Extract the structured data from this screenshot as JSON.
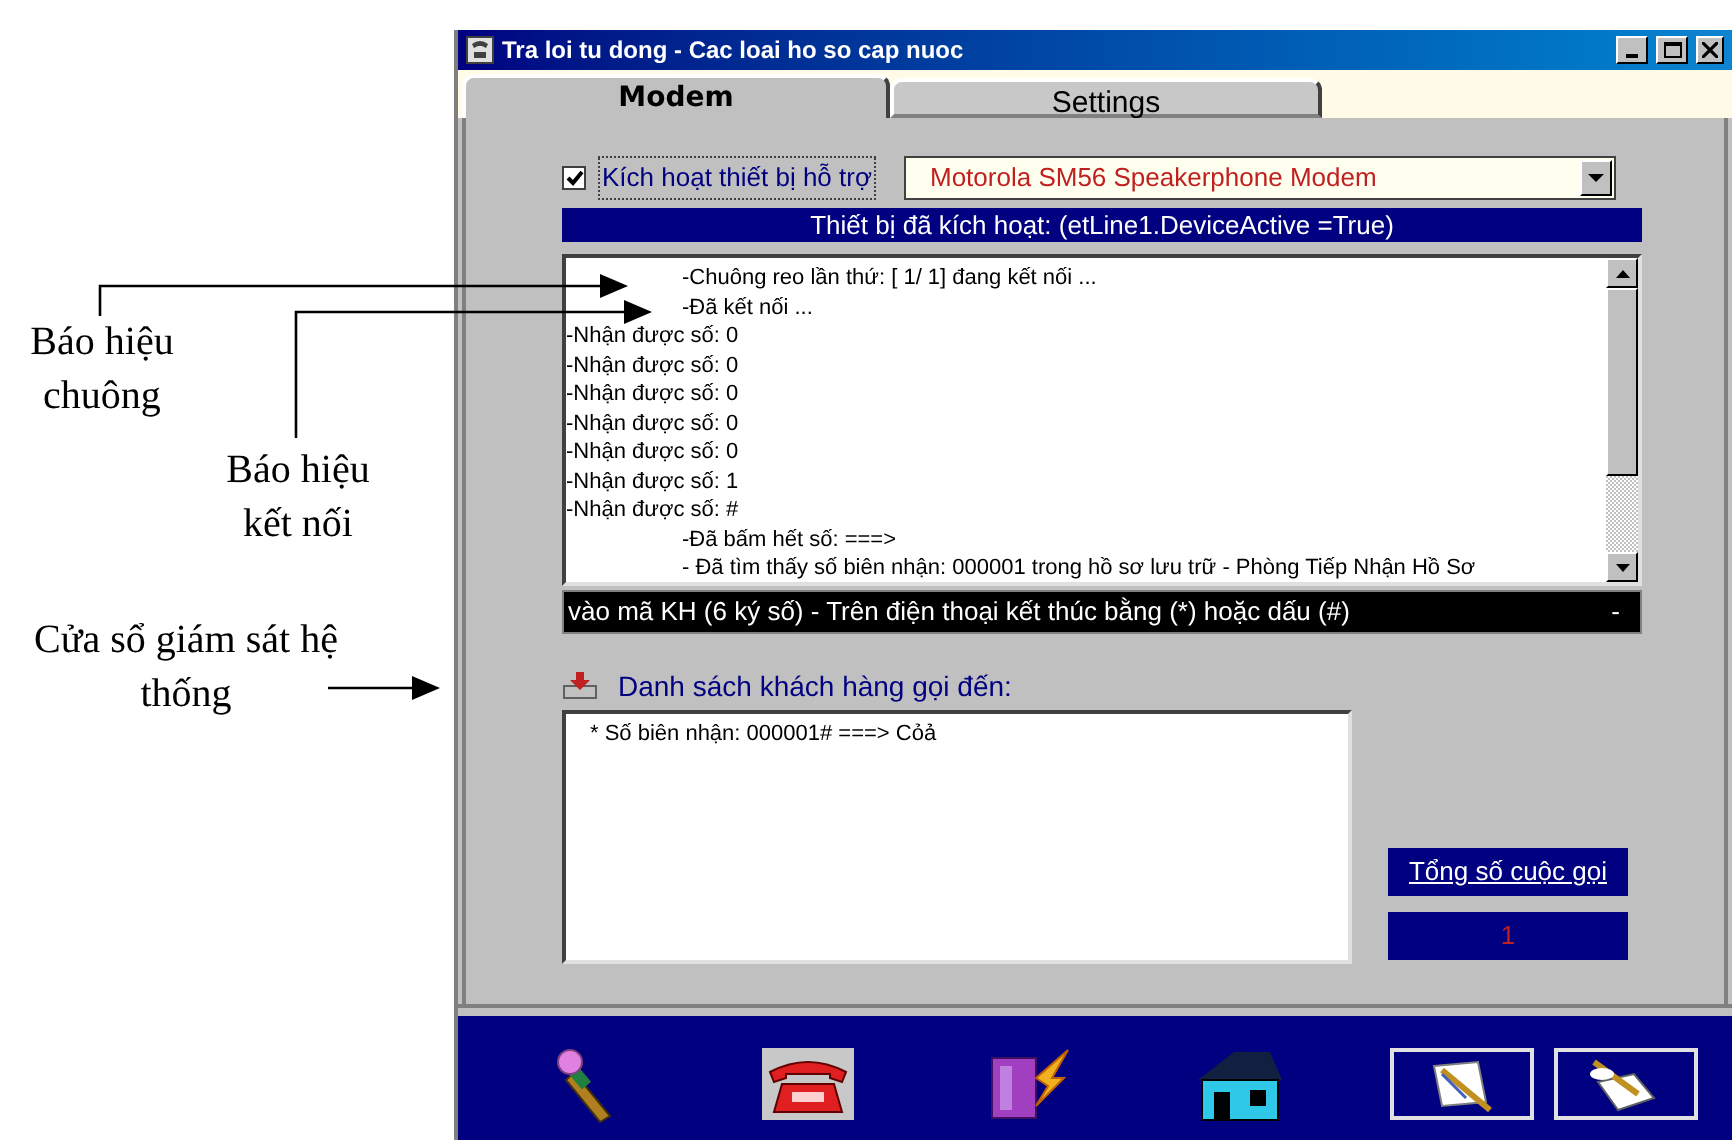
{
  "annotations": [
    {
      "text": "Báo hiệu chuông"
    },
    {
      "text": "Báo hiệu kết nối"
    },
    {
      "text": "Cửa sổ giám sát hệ thống"
    }
  ],
  "window": {
    "title": "Tra loi tu dong - Cac loai ho so cap nuoc"
  },
  "tabs": [
    {
      "label": "Modem",
      "selected": true
    },
    {
      "label": "Settings",
      "selected": false
    }
  ],
  "device": {
    "checkbox_label": "Kích hoạt thiết bị hỗ trợ",
    "checked": true,
    "modem": "Motorola SM56 Speakerphone Modem"
  },
  "status_banner": "Thiết bị đã kích hoạt: (etLine1.DeviceActive =True)",
  "log": [
    {
      "kind": "event",
      "text": "-Chuông reo lần thứ:  [ 1/ 1] đang kết nối ..."
    },
    {
      "kind": "event",
      "text": "-Đã kết nối ..."
    },
    {
      "kind": "digit",
      "text": "-Nhận được số: 0"
    },
    {
      "kind": "digit",
      "text": "-Nhận được số: 0"
    },
    {
      "kind": "digit",
      "text": "-Nhận được số: 0"
    },
    {
      "kind": "digit",
      "text": "-Nhận được số: 0"
    },
    {
      "kind": "digit",
      "text": "-Nhận được số: 0"
    },
    {
      "kind": "digit",
      "text": "-Nhận được số: 1"
    },
    {
      "kind": "digit",
      "text": "-Nhận được số: #"
    },
    {
      "kind": "event",
      "text": "-Đã bấm hết số: ===>"
    },
    {
      "kind": "event",
      "text": "- Đã tìm thấy số biên nhận: 000001 trong hồ sơ lưu trữ - Phòng Tiếp Nhận Hồ Sơ"
    }
  ],
  "ticker": {
    "text": "vào mã KH (6 ký số) - Trên điện thoại kết thúc bằng  (*) hoặc dấu  (#)",
    "tail": "-"
  },
  "callers": {
    "title": "Danh sách khách hàng gọi đến:",
    "items": [
      "* Số biên nhận: 000001# ===> Cỏả"
    ]
  },
  "total": {
    "label": "Tổng số cuộc gọi",
    "value": "1"
  },
  "toolbar": [
    {
      "kind": "plain"
    },
    {
      "kind": "plain"
    },
    {
      "kind": "plain"
    },
    {
      "kind": "plain"
    },
    {
      "kind": "framed"
    },
    {
      "kind": "framed"
    }
  ]
}
